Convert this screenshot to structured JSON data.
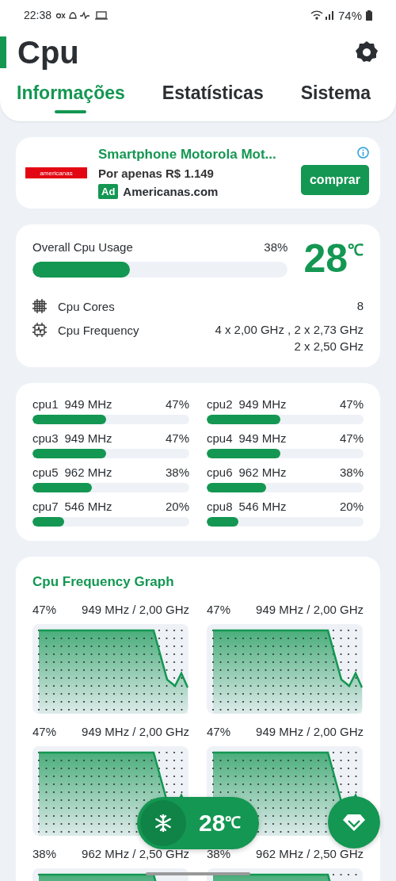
{
  "status_bar": {
    "time": "22:38",
    "battery": "74%"
  },
  "header": {
    "title": "Cpu"
  },
  "tabs": [
    {
      "label": "Informações",
      "selected": true
    },
    {
      "label": "Estatísticas",
      "selected": false
    },
    {
      "label": "Sistema",
      "selected": false
    }
  ],
  "ad": {
    "logo": "americanas",
    "title": "Smartphone Motorola Mot...",
    "subtitle": "Por apenas R$ 1.149",
    "badge": "Ad",
    "advertiser": "Americanas.com",
    "button": "comprar"
  },
  "usage": {
    "label": "Overall Cpu Usage",
    "reading": "38%",
    "level": 0.38,
    "temperature": "28",
    "unit": "℃",
    "details": [
      {
        "kind": "cores",
        "label": "Cpu Cores",
        "lines": [
          "8"
        ]
      },
      {
        "kind": "frequency",
        "label": "Cpu Frequency",
        "lines": [
          "4 x 2,00 GHz , 2 x 2,73 GHz",
          "2 x 2,50 GHz"
        ]
      }
    ]
  },
  "cores": [
    {
      "name": "cpu1",
      "frequency": "949 MHz",
      "reading": "47%",
      "level": 0.47
    },
    {
      "name": "cpu2",
      "frequency": "949 MHz",
      "reading": "47%",
      "level": 0.47
    },
    {
      "name": "cpu3",
      "frequency": "949 MHz",
      "reading": "47%",
      "level": 0.47
    },
    {
      "name": "cpu4",
      "frequency": "949 MHz",
      "reading": "47%",
      "level": 0.47
    },
    {
      "name": "cpu5",
      "frequency": "962 MHz",
      "reading": "38%",
      "level": 0.38
    },
    {
      "name": "cpu6",
      "frequency": "962 MHz",
      "reading": "38%",
      "level": 0.38
    },
    {
      "name": "cpu7",
      "frequency": "546 MHz",
      "reading": "20%",
      "level": 0.2
    },
    {
      "name": "cpu8",
      "frequency": "546 MHz",
      "reading": "20%",
      "level": 0.2
    }
  ],
  "graph": {
    "title": "Cpu Frequency Graph",
    "items": [
      {
        "reading": "47%",
        "frequency": "949 MHz / 2,00 GHz"
      },
      {
        "reading": "47%",
        "frequency": "949 MHz / 2,00 GHz"
      },
      {
        "reading": "47%",
        "frequency": "949 MHz / 2,00 GHz"
      },
      {
        "reading": "47%",
        "frequency": "949 MHz / 2,00 GHz"
      },
      {
        "reading": "38%",
        "frequency": "962 MHz / 2,50 GHz"
      },
      {
        "reading": "38%",
        "frequency": "962 MHz / 2,50 GHz"
      }
    ]
  },
  "floating": {
    "temperature": "28",
    "unit": "℃"
  }
}
